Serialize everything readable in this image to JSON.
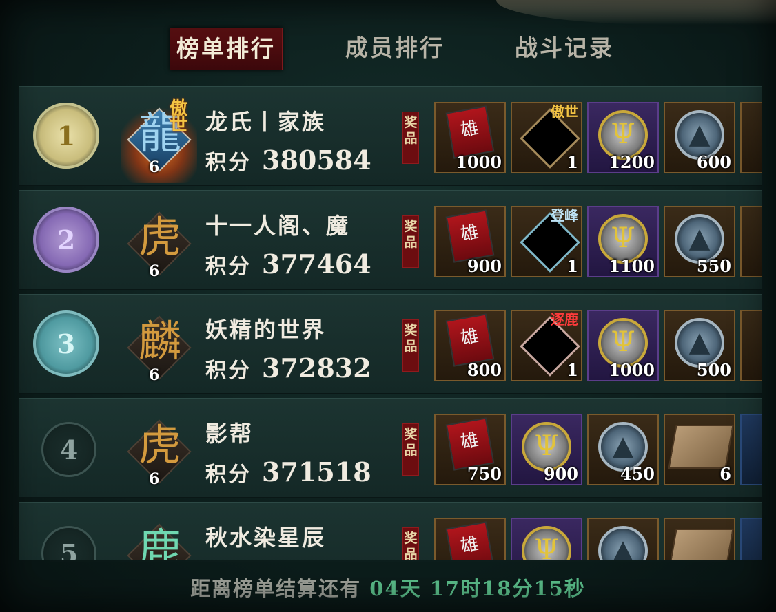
{
  "tabs": [
    {
      "label": "榜单排行",
      "active": true
    },
    {
      "label": "成员排行",
      "active": false
    },
    {
      "label": "战斗记录",
      "active": false
    }
  ],
  "prize_label": "奖品",
  "score_label": "积分",
  "rows": [
    {
      "rank": "1",
      "name": "龙氏丨家族",
      "score": "380584",
      "level": "6",
      "emblem_tag": "傲世",
      "items": [
        {
          "icon": "mask-token-icon",
          "qty": "1000",
          "frame": "gold"
        },
        {
          "icon": "title-frame-icon",
          "qty": "1",
          "frame": "gold",
          "tag": "傲世"
        },
        {
          "icon": "antler-coin-icon",
          "qty": "1200",
          "frame": "purple"
        },
        {
          "icon": "mountain-coin-icon",
          "qty": "600",
          "frame": "gold"
        }
      ]
    },
    {
      "rank": "2",
      "name": "十一人阁、魔",
      "score": "377464",
      "level": "6",
      "items": [
        {
          "icon": "mask-token-icon",
          "qty": "900",
          "frame": "gold"
        },
        {
          "icon": "title-frame-icon",
          "qty": "1",
          "frame": "gold",
          "tag": "登峰"
        },
        {
          "icon": "antler-coin-icon",
          "qty": "1100",
          "frame": "purple"
        },
        {
          "icon": "mountain-coin-icon",
          "qty": "550",
          "frame": "gold"
        }
      ]
    },
    {
      "rank": "3",
      "name": "妖精的世界",
      "score": "372832",
      "level": "6",
      "items": [
        {
          "icon": "mask-token-icon",
          "qty": "800",
          "frame": "gold"
        },
        {
          "icon": "title-frame-icon",
          "qty": "1",
          "frame": "gold",
          "tag": "逐鹿"
        },
        {
          "icon": "antler-coin-icon",
          "qty": "1000",
          "frame": "purple"
        },
        {
          "icon": "mountain-coin-icon",
          "qty": "500",
          "frame": "gold"
        }
      ]
    },
    {
      "rank": "4",
      "name": "影帮",
      "score": "371518",
      "level": "6",
      "items": [
        {
          "icon": "mask-token-icon",
          "qty": "750",
          "frame": "gold"
        },
        {
          "icon": "antler-coin-icon",
          "qty": "900",
          "frame": "purple"
        },
        {
          "icon": "mountain-coin-icon",
          "qty": "450",
          "frame": "gold"
        },
        {
          "icon": "scroll-map-icon",
          "qty": "6",
          "frame": "gold"
        }
      ]
    },
    {
      "rank": "5",
      "name": "秋水染星辰",
      "score": "",
      "level": "",
      "items": [
        {
          "icon": "mask-token-icon",
          "qty": "",
          "frame": "gold"
        },
        {
          "icon": "antler-coin-icon",
          "qty": "",
          "frame": "purple"
        },
        {
          "icon": "mountain-coin-icon",
          "qty": "",
          "frame": "gold"
        },
        {
          "icon": "scroll-map-icon",
          "qty": "",
          "frame": "gold"
        }
      ]
    }
  ],
  "footer": {
    "prefix": "距离榜单结算还有 ",
    "time": "04天 17时18分15秒"
  }
}
